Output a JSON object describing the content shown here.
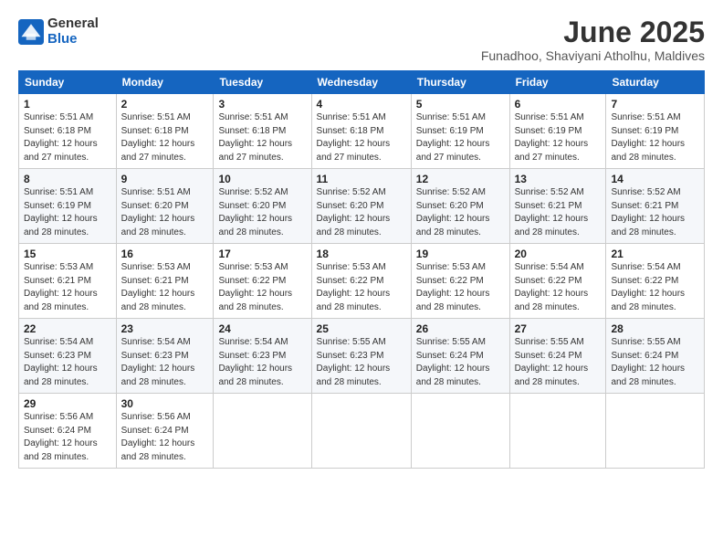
{
  "logo": {
    "general": "General",
    "blue": "Blue"
  },
  "title": "June 2025",
  "subtitle": "Funadhoo, Shaviyani Atholhu, Maldives",
  "headers": [
    "Sunday",
    "Monday",
    "Tuesday",
    "Wednesday",
    "Thursday",
    "Friday",
    "Saturday"
  ],
  "weeks": [
    [
      {
        "day": "1",
        "info": "Sunrise: 5:51 AM\nSunset: 6:18 PM\nDaylight: 12 hours and 27 minutes."
      },
      {
        "day": "2",
        "info": "Sunrise: 5:51 AM\nSunset: 6:18 PM\nDaylight: 12 hours and 27 minutes."
      },
      {
        "day": "3",
        "info": "Sunrise: 5:51 AM\nSunset: 6:18 PM\nDaylight: 12 hours and 27 minutes."
      },
      {
        "day": "4",
        "info": "Sunrise: 5:51 AM\nSunset: 6:18 PM\nDaylight: 12 hours and 27 minutes."
      },
      {
        "day": "5",
        "info": "Sunrise: 5:51 AM\nSunset: 6:19 PM\nDaylight: 12 hours and 27 minutes."
      },
      {
        "day": "6",
        "info": "Sunrise: 5:51 AM\nSunset: 6:19 PM\nDaylight: 12 hours and 27 minutes."
      },
      {
        "day": "7",
        "info": "Sunrise: 5:51 AM\nSunset: 6:19 PM\nDaylight: 12 hours and 28 minutes."
      }
    ],
    [
      {
        "day": "8",
        "info": "Sunrise: 5:51 AM\nSunset: 6:19 PM\nDaylight: 12 hours and 28 minutes."
      },
      {
        "day": "9",
        "info": "Sunrise: 5:51 AM\nSunset: 6:20 PM\nDaylight: 12 hours and 28 minutes."
      },
      {
        "day": "10",
        "info": "Sunrise: 5:52 AM\nSunset: 6:20 PM\nDaylight: 12 hours and 28 minutes."
      },
      {
        "day": "11",
        "info": "Sunrise: 5:52 AM\nSunset: 6:20 PM\nDaylight: 12 hours and 28 minutes."
      },
      {
        "day": "12",
        "info": "Sunrise: 5:52 AM\nSunset: 6:20 PM\nDaylight: 12 hours and 28 minutes."
      },
      {
        "day": "13",
        "info": "Sunrise: 5:52 AM\nSunset: 6:21 PM\nDaylight: 12 hours and 28 minutes."
      },
      {
        "day": "14",
        "info": "Sunrise: 5:52 AM\nSunset: 6:21 PM\nDaylight: 12 hours and 28 minutes."
      }
    ],
    [
      {
        "day": "15",
        "info": "Sunrise: 5:53 AM\nSunset: 6:21 PM\nDaylight: 12 hours and 28 minutes."
      },
      {
        "day": "16",
        "info": "Sunrise: 5:53 AM\nSunset: 6:21 PM\nDaylight: 12 hours and 28 minutes."
      },
      {
        "day": "17",
        "info": "Sunrise: 5:53 AM\nSunset: 6:22 PM\nDaylight: 12 hours and 28 minutes."
      },
      {
        "day": "18",
        "info": "Sunrise: 5:53 AM\nSunset: 6:22 PM\nDaylight: 12 hours and 28 minutes."
      },
      {
        "day": "19",
        "info": "Sunrise: 5:53 AM\nSunset: 6:22 PM\nDaylight: 12 hours and 28 minutes."
      },
      {
        "day": "20",
        "info": "Sunrise: 5:54 AM\nSunset: 6:22 PM\nDaylight: 12 hours and 28 minutes."
      },
      {
        "day": "21",
        "info": "Sunrise: 5:54 AM\nSunset: 6:22 PM\nDaylight: 12 hours and 28 minutes."
      }
    ],
    [
      {
        "day": "22",
        "info": "Sunrise: 5:54 AM\nSunset: 6:23 PM\nDaylight: 12 hours and 28 minutes."
      },
      {
        "day": "23",
        "info": "Sunrise: 5:54 AM\nSunset: 6:23 PM\nDaylight: 12 hours and 28 minutes."
      },
      {
        "day": "24",
        "info": "Sunrise: 5:54 AM\nSunset: 6:23 PM\nDaylight: 12 hours and 28 minutes."
      },
      {
        "day": "25",
        "info": "Sunrise: 5:55 AM\nSunset: 6:23 PM\nDaylight: 12 hours and 28 minutes."
      },
      {
        "day": "26",
        "info": "Sunrise: 5:55 AM\nSunset: 6:24 PM\nDaylight: 12 hours and 28 minutes."
      },
      {
        "day": "27",
        "info": "Sunrise: 5:55 AM\nSunset: 6:24 PM\nDaylight: 12 hours and 28 minutes."
      },
      {
        "day": "28",
        "info": "Sunrise: 5:55 AM\nSunset: 6:24 PM\nDaylight: 12 hours and 28 minutes."
      }
    ],
    [
      {
        "day": "29",
        "info": "Sunrise: 5:56 AM\nSunset: 6:24 PM\nDaylight: 12 hours and 28 minutes."
      },
      {
        "day": "30",
        "info": "Sunrise: 5:56 AM\nSunset: 6:24 PM\nDaylight: 12 hours and 28 minutes."
      },
      null,
      null,
      null,
      null,
      null
    ]
  ]
}
